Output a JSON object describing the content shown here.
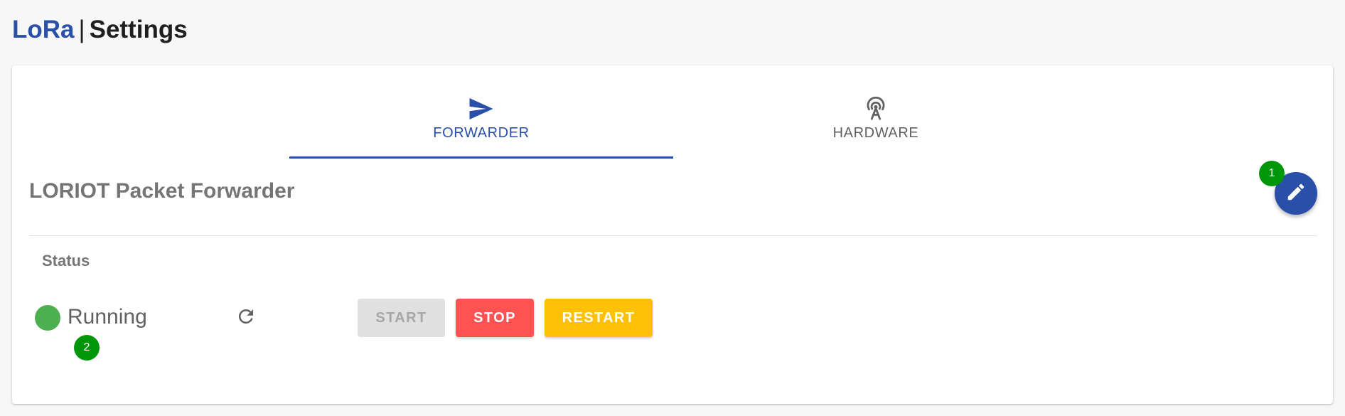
{
  "header": {
    "brand": "LoRa",
    "separator": "|",
    "title": "Settings"
  },
  "tabs": [
    {
      "label": "FORWARDER",
      "icon": "send-icon",
      "active": true
    },
    {
      "label": "HARDWARE",
      "icon": "antenna-icon",
      "active": false
    }
  ],
  "section": {
    "title": "LORIOT Packet Forwarder",
    "status_label": "Status",
    "status_value": "Running",
    "status_color": "#4caf50"
  },
  "actions": {
    "start_label": "START",
    "stop_label": "STOP",
    "restart_label": "RESTART",
    "refresh_icon": "refresh-icon",
    "edit_icon": "pencil-icon"
  },
  "markers": {
    "first": "1",
    "second": "2"
  },
  "colors": {
    "accent": "#2a4fa8",
    "stop": "#ff5252",
    "restart": "#ffc107",
    "marker": "#00960a"
  }
}
